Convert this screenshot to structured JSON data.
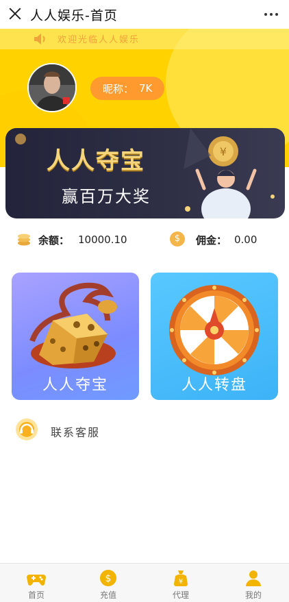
{
  "app": {
    "title": "人人娱乐-首页"
  },
  "marquee": {
    "text": "欢迎光临人人娱乐"
  },
  "profile": {
    "nickname_label": "昵称：",
    "nickname_value": "7K"
  },
  "banner": {
    "title": "人人夺宝",
    "subtitle": "赢百万大奖"
  },
  "balance": {
    "label": "余额：",
    "value": "10000.10"
  },
  "commission": {
    "label": "佣金：",
    "value": "0.00",
    "coin_glyph": "$"
  },
  "cards": [
    {
      "label": "人人夺宝"
    },
    {
      "label": "人人转盘"
    }
  ],
  "service": {
    "label": "联系客服"
  },
  "tabs": [
    {
      "label": "首页",
      "icon": "gamepad-icon"
    },
    {
      "label": "充值",
      "icon": "dollar-coin-icon"
    },
    {
      "label": "代理",
      "icon": "money-bag-icon"
    },
    {
      "label": "我的",
      "icon": "user-icon"
    }
  ],
  "colors": {
    "accent": "#ffd200",
    "orange": "#ff9a2e",
    "tab_icon": "#f2b400"
  }
}
